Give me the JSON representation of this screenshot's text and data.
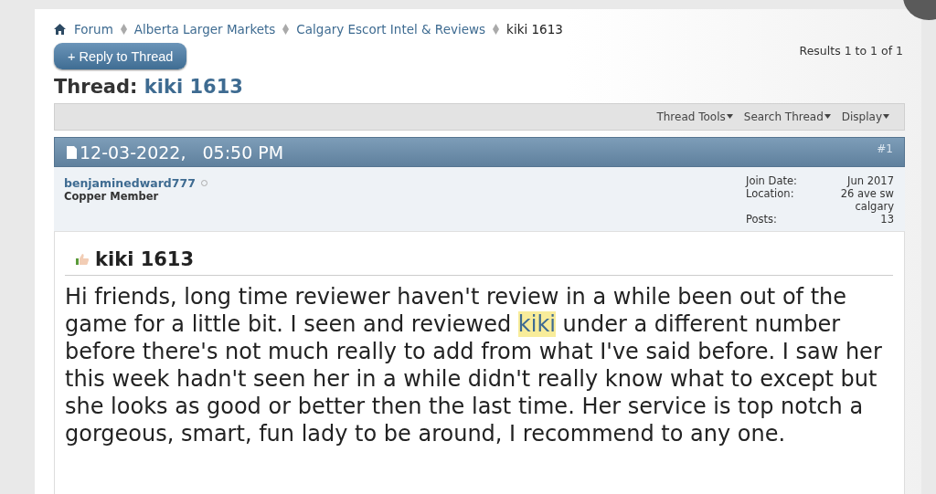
{
  "breadcrumb": [
    {
      "label": "Forum",
      "kind": "link"
    },
    {
      "label": "Alberta Larger Markets",
      "kind": "link"
    },
    {
      "label": "Calgary Escort Intel & Reviews",
      "kind": "link"
    },
    {
      "label": "kiki 1613",
      "kind": "current"
    }
  ],
  "reply_button": "+ Reply to Thread",
  "results": "Results 1 to 1 of 1",
  "thread": {
    "prefix": "Thread:",
    "title": "kiki 1613"
  },
  "toolbar": [
    "Thread Tools",
    "Search Thread",
    "Display"
  ],
  "post": {
    "date": "12-03-2022,",
    "time": "05:50 PM",
    "number": "#1",
    "user": {
      "name": "benjaminedward777",
      "online": false,
      "rank": "Copper Member"
    },
    "info": [
      {
        "label": "Join Date:",
        "value": "Jun 2017"
      },
      {
        "label": "Location:",
        "value": "26 ave sw calgary"
      },
      {
        "label": "Posts:",
        "value": "13"
      }
    ],
    "title": "kiki 1613",
    "body": [
      [
        {
          "text": "Hi friends, long time reviewer haven't review in a while been out of the",
          "highlighted": false
        }
      ],
      [
        {
          "text": "game for a little bit. I seen and reviewed ",
          "highlighted": false
        },
        {
          "text": "kiki",
          "highlighted": true
        },
        {
          "text": " under a different number",
          "highlighted": false
        }
      ],
      [
        {
          "text": "before there's not much really to add from what I've said before. I saw her",
          "highlighted": false
        }
      ],
      [
        {
          "text": "this week hadn't seen her in a while didn't really know what to except but",
          "highlighted": false
        }
      ],
      [
        {
          "text": "she looks as good or better then the last time. Her service is top notch a",
          "highlighted": false
        }
      ],
      [
        {
          "text": "gorgeous, smart, fun lady to be around, I recommend to any one.",
          "highlighted": false
        }
      ]
    ]
  }
}
